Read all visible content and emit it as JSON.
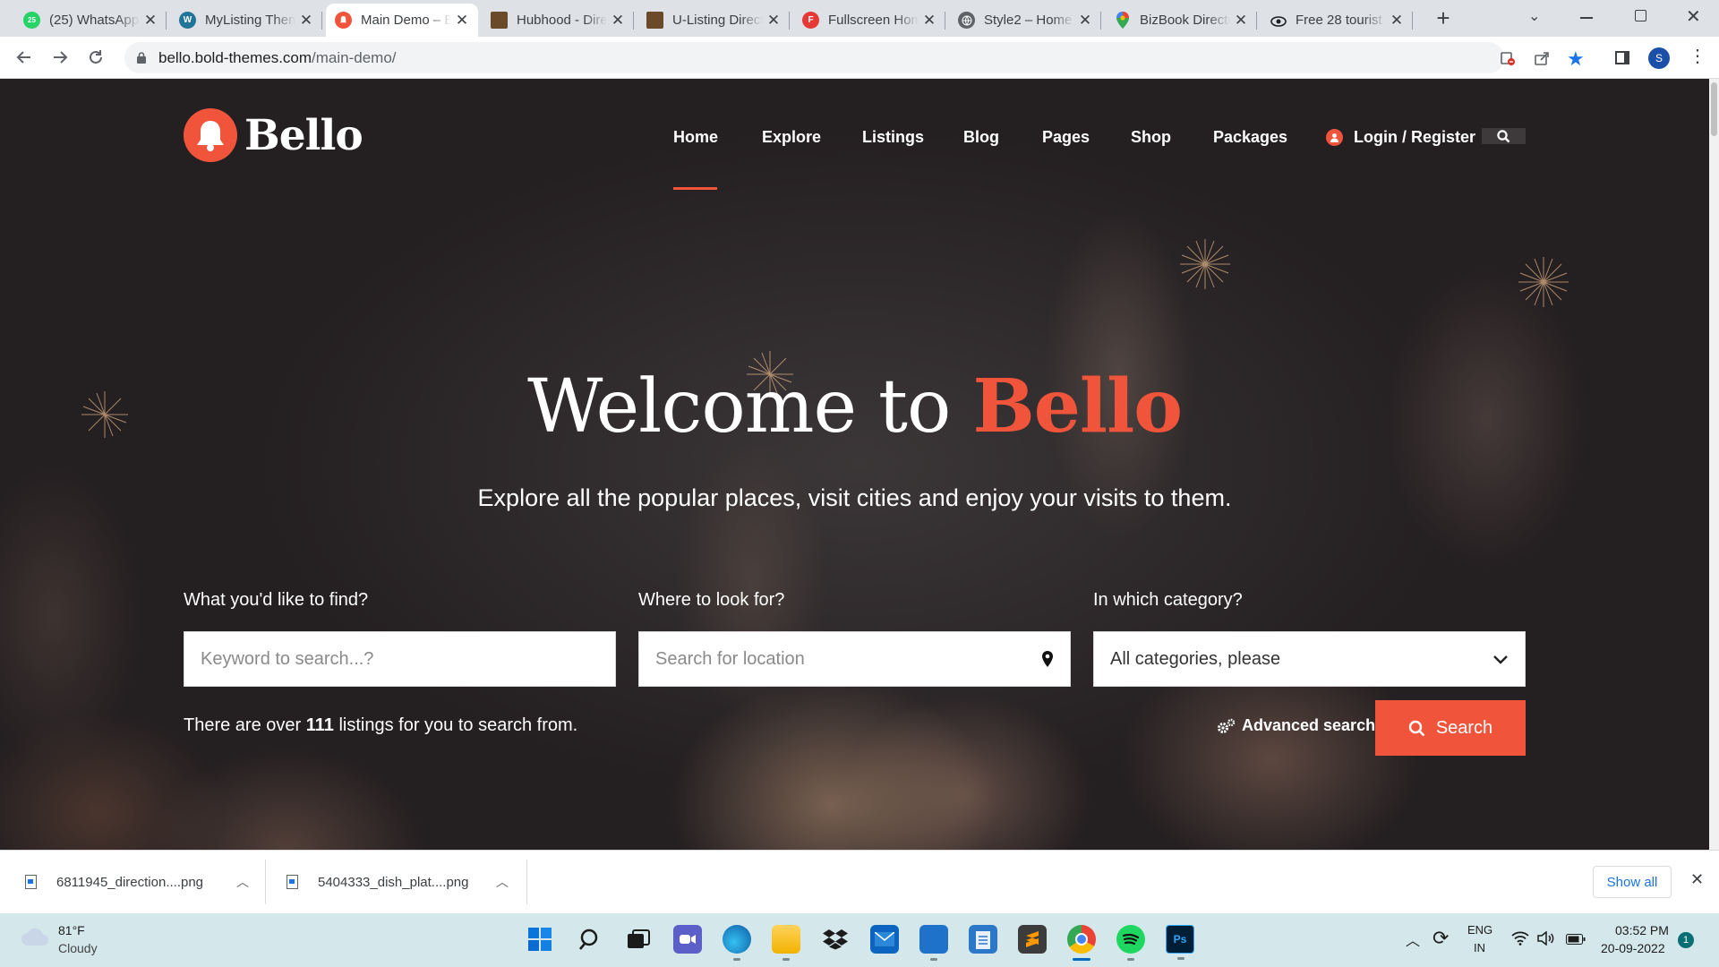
{
  "browser": {
    "tabs": [
      {
        "title": "(25) WhatsApp",
        "icon": "whatsapp-icon",
        "color": "#25d366",
        "badge": "25"
      },
      {
        "title": "MyListing Theme",
        "icon": "wordpress-icon",
        "color": "#21759b",
        "badge": "W"
      },
      {
        "title": "Main Demo – Bello",
        "icon": "bello-icon",
        "color": "#f0553c",
        "badge": ""
      },
      {
        "title": "Hubhood - Directory",
        "icon": "hubhood-icon",
        "color": "#6b4a2a",
        "badge": ""
      },
      {
        "title": "U-Listing Directory",
        "icon": "ulisting-icon",
        "color": "#6b4a2a",
        "badge": ""
      },
      {
        "title": "Fullscreen Home",
        "icon": "f-icon",
        "color": "#e53935",
        "badge": "F"
      },
      {
        "title": "Style2 – Home",
        "icon": "globe-icon",
        "color": "#5f6368",
        "badge": ""
      },
      {
        "title": "BizBook Directory",
        "icon": "maps-pin-icon",
        "color": "#34a853",
        "badge": ""
      },
      {
        "title": "Free 28 tourist",
        "icon": "eye-icon",
        "color": "#202124",
        "badge": ""
      }
    ],
    "url_host": "bello.bold-themes.com",
    "url_path": "/main-demo/",
    "profile_initial": "S"
  },
  "site": {
    "logo": "Bello",
    "nav": [
      "Home",
      "Explore",
      "Listings",
      "Blog",
      "Pages",
      "Shop",
      "Packages"
    ],
    "login": "Login / Register",
    "hero": {
      "title_lead": "Welcome to",
      "title_accent": "Bello",
      "subtitle": "Explore all the popular places, visit cities and enjoy your visits to them."
    },
    "search": {
      "keyword_label": "What you'd like to find?",
      "keyword_placeholder": "Keyword to search...?",
      "location_label": "Where to look for?",
      "location_placeholder": "Search for location",
      "category_label": "In which category?",
      "category_value": "All categories, please",
      "count_pre": "There are over ",
      "count_num": "111",
      "count_post": " listings for you to search from.",
      "advanced": "Advanced search",
      "button": "Search"
    },
    "accent_color": "#f0553c"
  },
  "downloads": {
    "items": [
      "6811945_direction....png",
      "5404333_dish_plat....png"
    ],
    "show_all": "Show all"
  },
  "taskbar": {
    "weather_temp": "81°F",
    "weather_desc": "Cloudy",
    "lang": "ENG",
    "region": "IN",
    "time": "03:52 PM",
    "date": "20-09-2022",
    "notifications": "1"
  }
}
